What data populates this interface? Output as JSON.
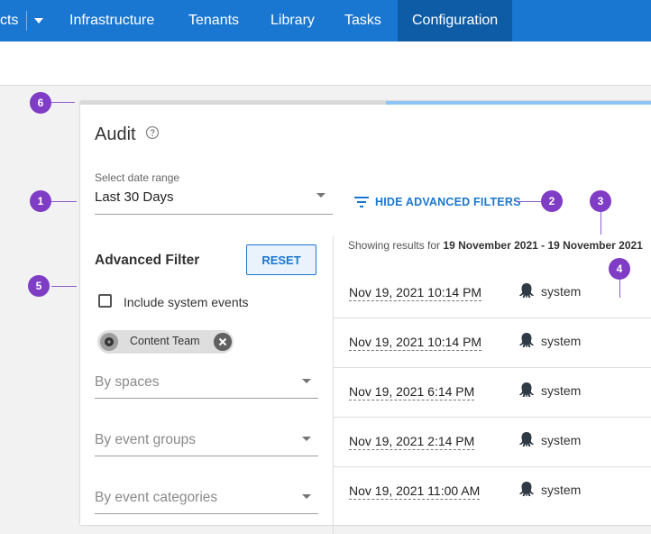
{
  "topnav": {
    "items": [
      {
        "label": "cts"
      },
      {
        "label": "Infrastructure"
      },
      {
        "label": "Tenants"
      },
      {
        "label": "Library"
      },
      {
        "label": "Tasks"
      },
      {
        "label": "Configuration",
        "active": true
      }
    ]
  },
  "audit": {
    "title": "Audit",
    "date_range": {
      "label": "Select date range",
      "value": "Last 30 Days"
    },
    "toggle_filters_label": "HIDE ADVANCED FILTERS",
    "progress_fraction": 0.47
  },
  "advanced_filter": {
    "title": "Advanced Filter",
    "reset_label": "RESET",
    "include_system_events": {
      "label": "Include system events",
      "checked": false
    },
    "chip": {
      "label": "Content Team"
    },
    "selects": [
      {
        "placeholder": "By spaces"
      },
      {
        "placeholder": "By event groups"
      },
      {
        "placeholder": "By event categories"
      }
    ]
  },
  "results": {
    "summary_prefix": "Showing results for",
    "summary_range": "19 November 2021 - 19 November 2021",
    "rows": [
      {
        "timestamp": "Nov 19, 2021 10:14 PM",
        "user": "system"
      },
      {
        "timestamp": "Nov 19, 2021 10:14 PM",
        "user": "system"
      },
      {
        "timestamp": "Nov 19, 2021 6:14 PM",
        "user": "system"
      },
      {
        "timestamp": "Nov 19, 2021 2:14 PM",
        "user": "system"
      },
      {
        "timestamp": "Nov 19, 2021 11:00 AM",
        "user": "system"
      }
    ]
  },
  "annotations": [
    "1",
    "2",
    "3",
    "4",
    "5",
    "6"
  ],
  "colors": {
    "nav": "#1a77d1",
    "nav_active": "#0f5ca6",
    "accent": "#1a77d1",
    "badge": "#7f3cc4"
  }
}
